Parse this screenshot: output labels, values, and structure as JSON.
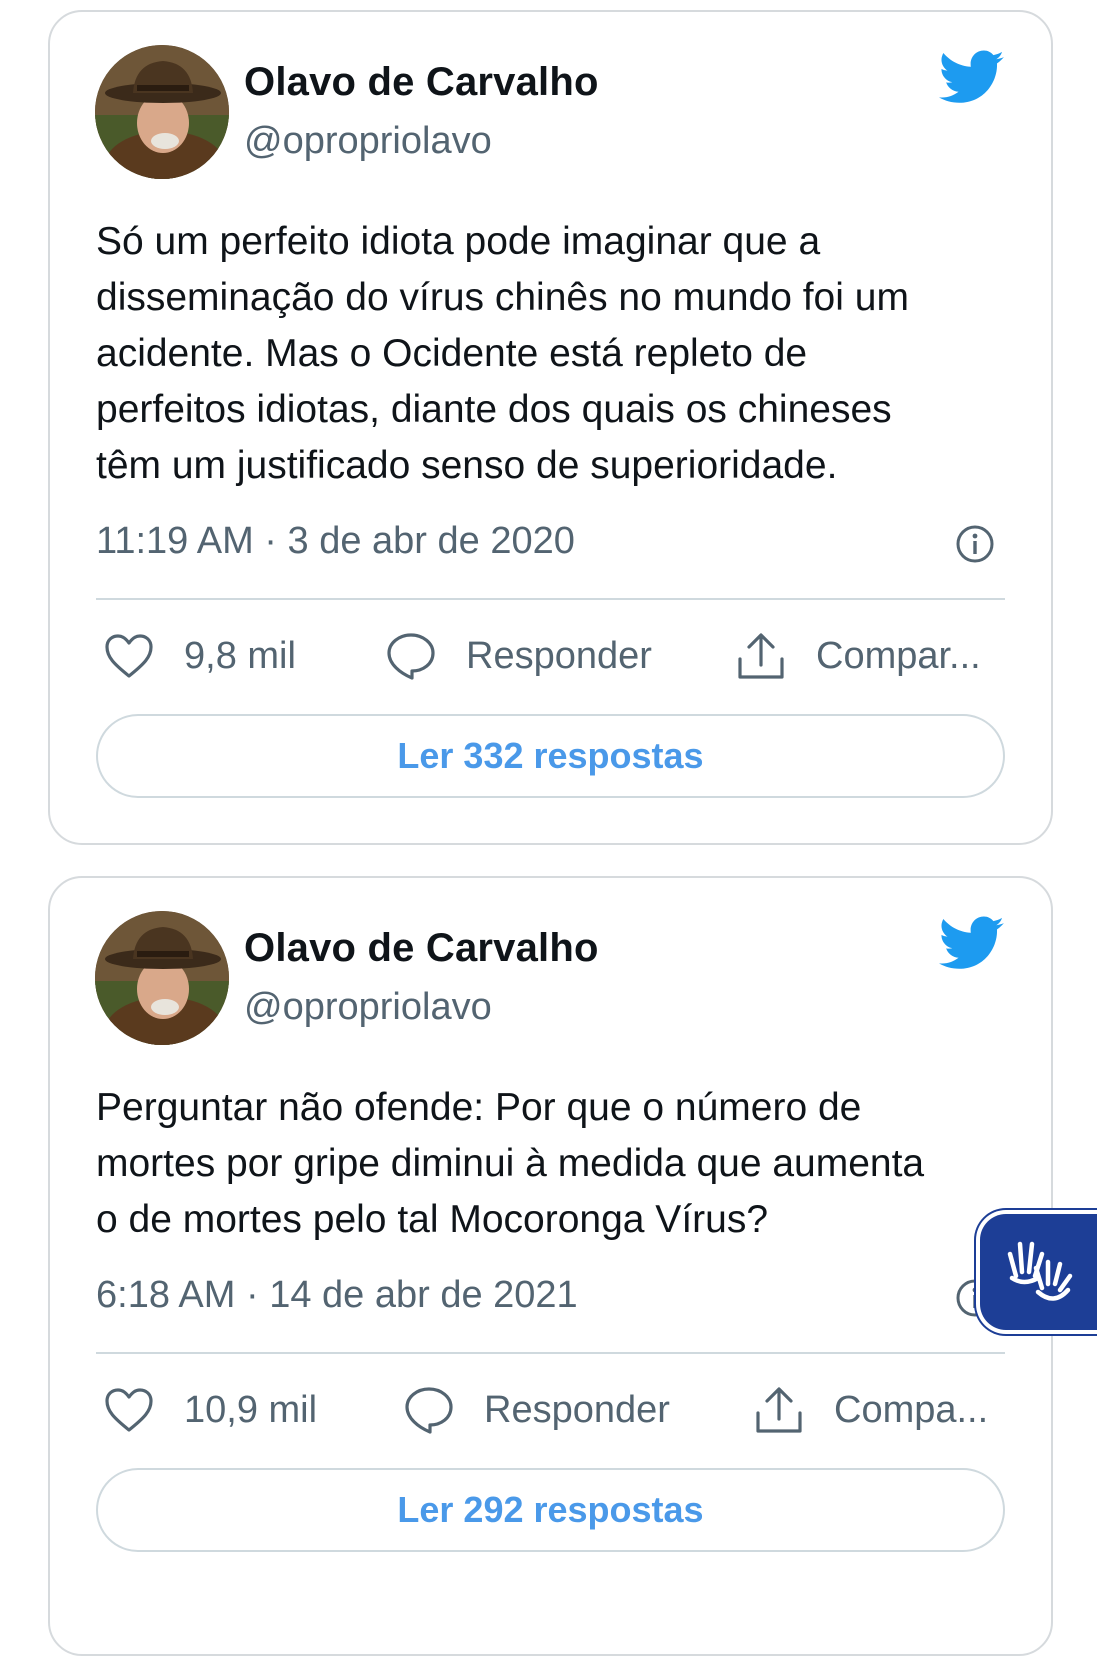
{
  "colors": {
    "twitter_blue": "#1d9bf0",
    "link_blue": "#4a99e9",
    "secondary_text": "#536471",
    "accessibility_widget": "#1d3e96"
  },
  "tweets": [
    {
      "author_name": "Olavo de Carvalho",
      "handle": "@opropriolavo",
      "text": "Só um perfeito idiota pode imaginar que a\ndisseminação do  vírus chinês no mundo foi um\nacidente. Mas o Ocidente está repleto de\nperfeitos idiotas, diante dos quais os chineses\ntêm um justificado senso de superioridade.",
      "timestamp": "11:19 AM · 3 de abr de 2020",
      "likes": "9,8 mil",
      "reply_label": "Responder",
      "share_label": "Compar...",
      "read_replies": "Ler 332 respostas",
      "icons": [
        "twitter-bird-icon",
        "info-icon",
        "heart-icon",
        "reply-bubble-icon",
        "share-icon"
      ]
    },
    {
      "author_name": "Olavo de Carvalho",
      "handle": "@opropriolavo",
      "text": "Perguntar não ofende: Por que o número de\nmortes por gripe diminui à medida que aumenta\no de mortes pelo tal Mocoronga Vírus?",
      "timestamp": "6:18 AM · 14 de abr de 2021",
      "likes": "10,9 mil",
      "reply_label": "Responder",
      "share_label": "Compa...",
      "read_replies": "Ler 292 respostas",
      "icons": [
        "twitter-bird-icon",
        "info-icon",
        "heart-icon",
        "reply-bubble-icon",
        "share-icon"
      ]
    }
  ],
  "accessibility_widget": {
    "icon": "sign-language-hands-icon"
  }
}
